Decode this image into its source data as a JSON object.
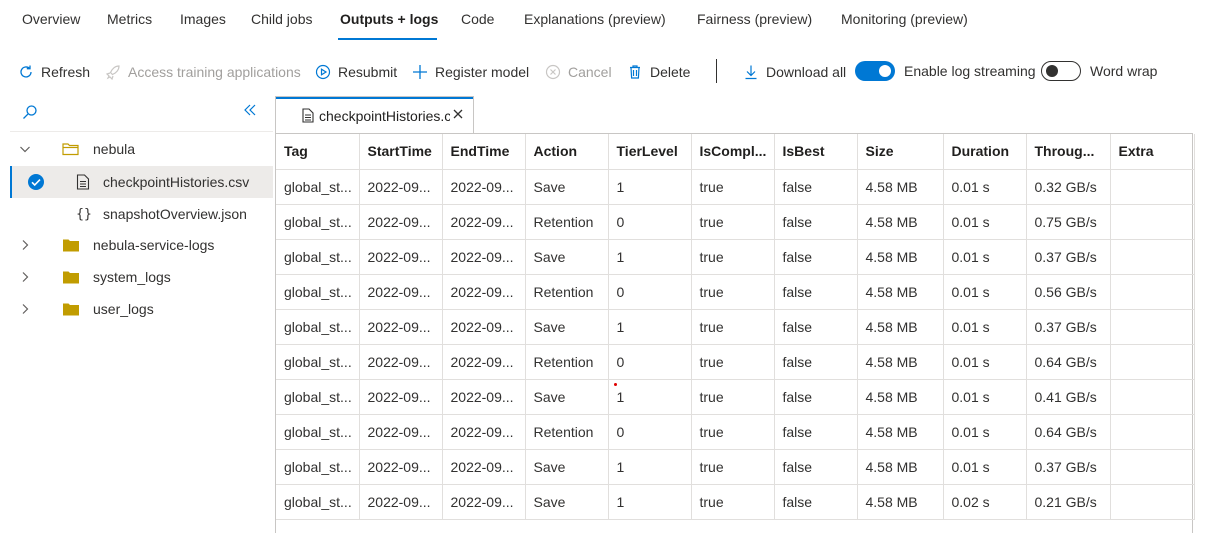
{
  "tabs": [
    "Overview",
    "Metrics",
    "Images",
    "Child jobs",
    "Outputs + logs",
    "Code",
    "Explanations (preview)",
    "Fairness (preview)",
    "Monitoring (preview)"
  ],
  "active_tab": "Outputs + logs",
  "toolbar": {
    "refresh": "Refresh",
    "access_training": "Access training applications",
    "resubmit": "Resubmit",
    "register_model": "Register model",
    "cancel": "Cancel",
    "delete": "Delete",
    "download_all": "Download all",
    "log_streaming": "Enable log streaming",
    "log_streaming_on": true,
    "word_wrap": "Word wrap",
    "word_wrap_on": false
  },
  "tree": {
    "items": [
      {
        "label": "nebula",
        "kind": "folder-open",
        "level": 0,
        "expanded": true
      },
      {
        "label": "checkpointHistories.csv",
        "kind": "file",
        "level": 1,
        "selected": true
      },
      {
        "label": "snapshotOverview.json",
        "kind": "json",
        "level": 1
      },
      {
        "label": "nebula-service-logs",
        "kind": "folder",
        "level": 0,
        "expanded": false
      },
      {
        "label": "system_logs",
        "kind": "folder",
        "level": 0,
        "expanded": false
      },
      {
        "label": "user_logs",
        "kind": "folder",
        "level": 0,
        "expanded": false
      }
    ]
  },
  "open_file": {
    "name": "checkpointHistories.c"
  },
  "table": {
    "columns": [
      "Tag",
      "StartTime",
      "EndTime",
      "Action",
      "TierLevel",
      "IsCompl...",
      "IsBest",
      "Size",
      "Duration",
      "Throug...",
      "Extra"
    ],
    "rows": [
      [
        "global_st...",
        "2022-09...",
        "2022-09...",
        "Save",
        "1",
        "true",
        "false",
        "4.58 MB",
        "0.01 s",
        "0.32 GB/s",
        ""
      ],
      [
        "global_st...",
        "2022-09...",
        "2022-09...",
        "Retention",
        "0",
        "true",
        "false",
        "4.58 MB",
        "0.01 s",
        "0.75 GB/s",
        ""
      ],
      [
        "global_st...",
        "2022-09...",
        "2022-09...",
        "Save",
        "1",
        "true",
        "false",
        "4.58 MB",
        "0.01 s",
        "0.37 GB/s",
        ""
      ],
      [
        "global_st...",
        "2022-09...",
        "2022-09...",
        "Retention",
        "0",
        "true",
        "false",
        "4.58 MB",
        "0.01 s",
        "0.56 GB/s",
        ""
      ],
      [
        "global_st...",
        "2022-09...",
        "2022-09...",
        "Save",
        "1",
        "true",
        "false",
        "4.58 MB",
        "0.01 s",
        "0.37 GB/s",
        ""
      ],
      [
        "global_st...",
        "2022-09...",
        "2022-09...",
        "Retention",
        "0",
        "true",
        "false",
        "4.58 MB",
        "0.01 s",
        "0.64 GB/s",
        ""
      ],
      [
        "global_st...",
        "2022-09...",
        "2022-09...",
        "Save",
        "1",
        "true",
        "false",
        "4.58 MB",
        "0.01 s",
        "0.41 GB/s",
        ""
      ],
      [
        "global_st...",
        "2022-09...",
        "2022-09...",
        "Retention",
        "0",
        "true",
        "false",
        "4.58 MB",
        "0.01 s",
        "0.64 GB/s",
        ""
      ],
      [
        "global_st...",
        "2022-09...",
        "2022-09...",
        "Save",
        "1",
        "true",
        "false",
        "4.58 MB",
        "0.01 s",
        "0.37 GB/s",
        ""
      ],
      [
        "global_st...",
        "2022-09...",
        "2022-09...",
        "Save",
        "1",
        "true",
        "false",
        "4.58 MB",
        "0.02 s",
        "0.21 GB/s",
        ""
      ]
    ]
  },
  "colors": {
    "accent": "#0078d4",
    "folder": "#c19c00",
    "disabled": "#a19f9d"
  }
}
